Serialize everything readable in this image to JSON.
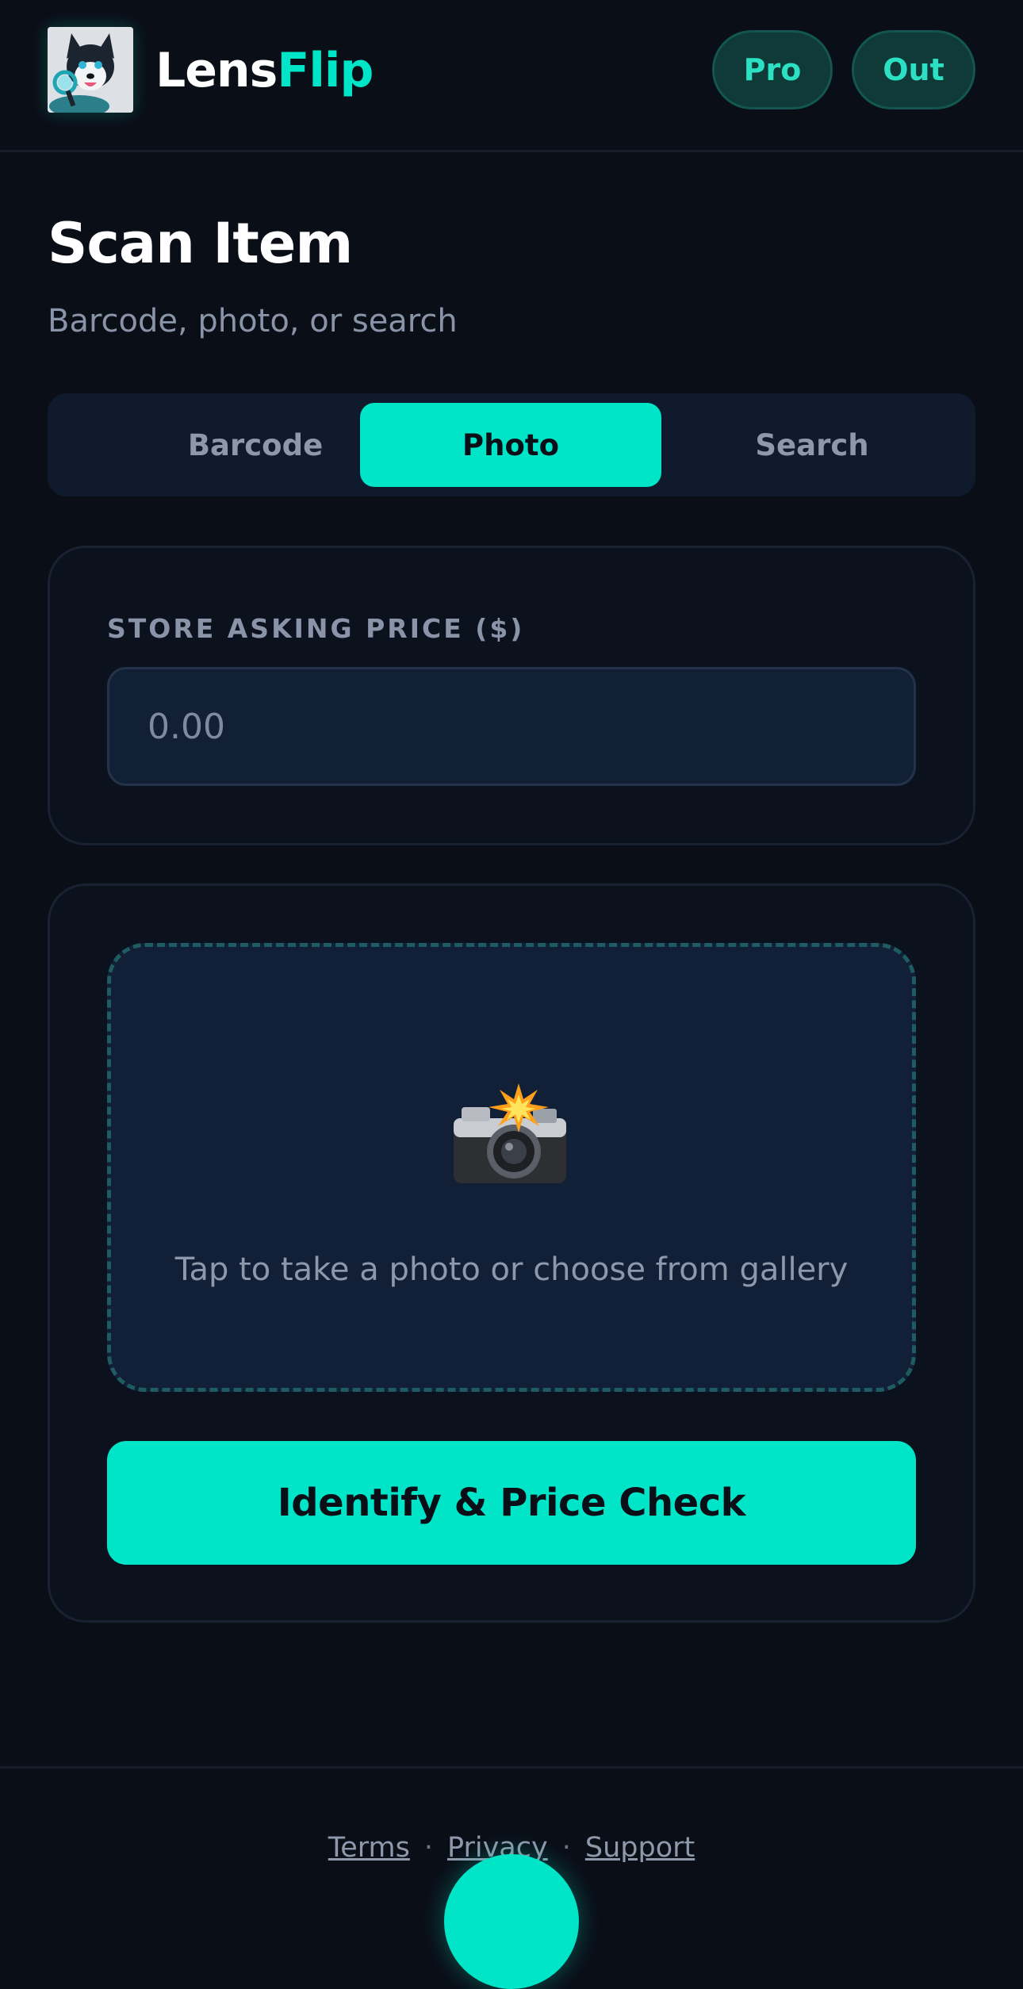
{
  "header": {
    "brand_part1": "Lens",
    "brand_part2": "Flip",
    "pro_label": "Pro",
    "out_label": "Out"
  },
  "page": {
    "title": "Scan Item",
    "subtitle": "Barcode, photo, or search"
  },
  "tabs": [
    {
      "label": "Barcode",
      "active": false
    },
    {
      "label": "Photo",
      "active": true
    },
    {
      "label": "Search",
      "active": false
    }
  ],
  "price": {
    "label": "STORE ASKING PRICE ($)",
    "placeholder": "0.00",
    "value": ""
  },
  "upload": {
    "icon": "camera-flash-icon",
    "text": "Tap to take a photo or choose from gallery"
  },
  "cta_label": "Identify & Price Check",
  "footer": {
    "links": [
      "Terms",
      "Privacy",
      "Support"
    ],
    "separator": "·"
  },
  "colors": {
    "background": "#0a0e17",
    "accent": "#00e5c8",
    "card": "#0b111d",
    "input": "#122036",
    "muted_text": "#8e98ab"
  }
}
